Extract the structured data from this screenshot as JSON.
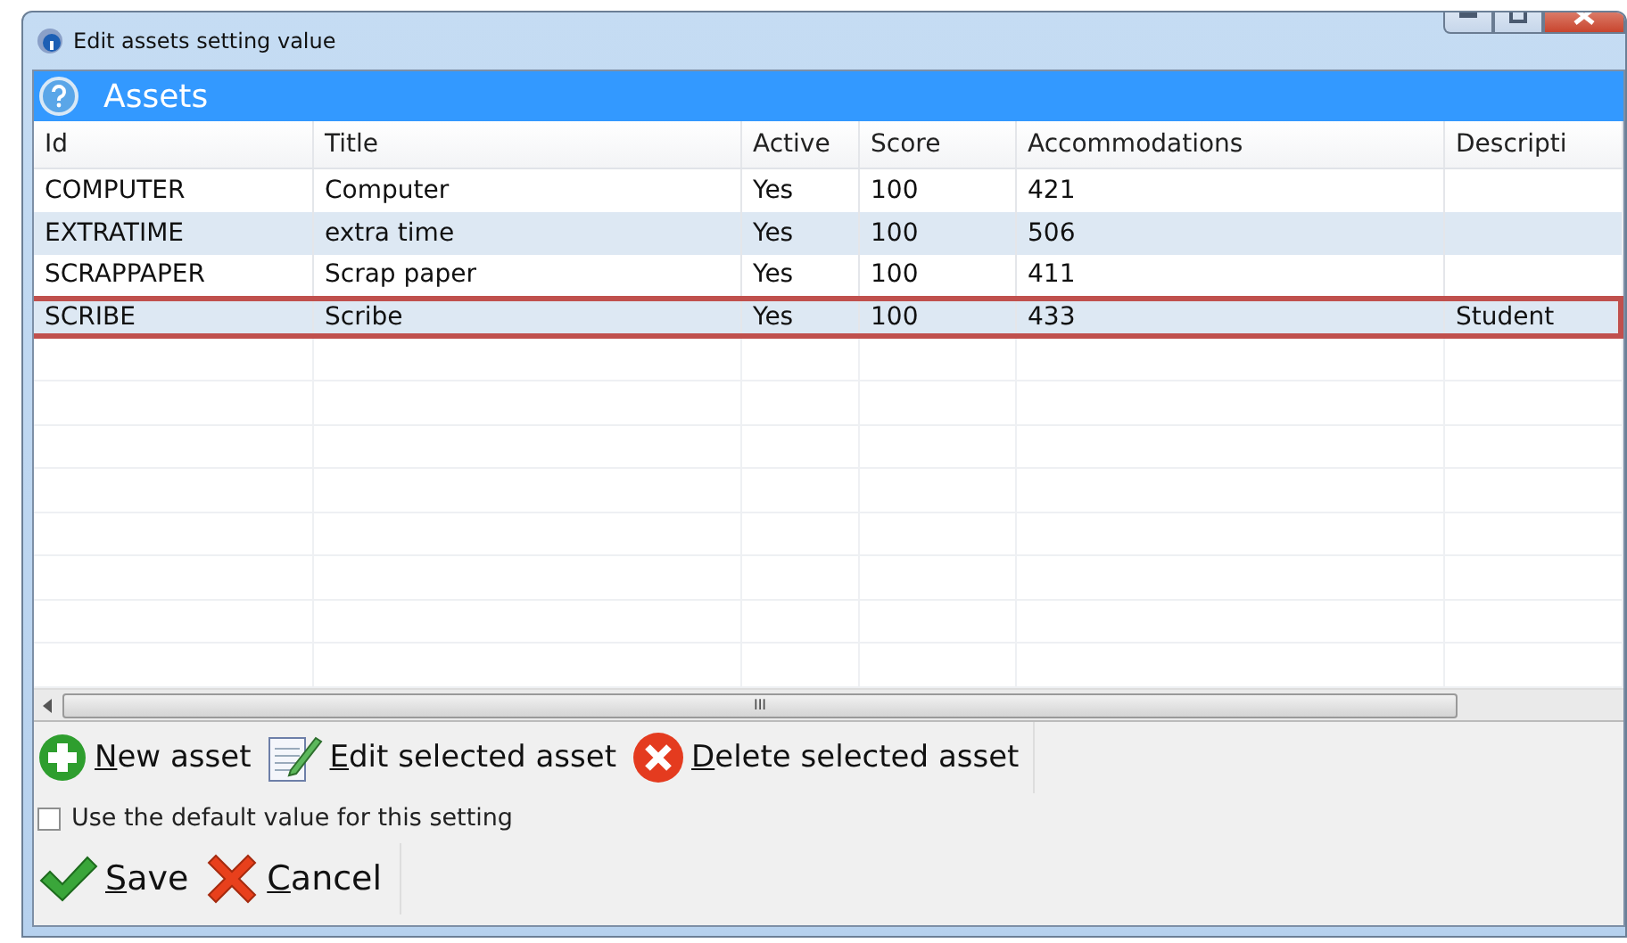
{
  "window": {
    "title": "Edit assets setting value"
  },
  "header": {
    "title": "Assets"
  },
  "table": {
    "columns": [
      "Id",
      "Title",
      "Active",
      "Score",
      "Accommodations",
      "Descripti"
    ],
    "rows": [
      {
        "cells": [
          "COMPUTER",
          "Computer",
          "Yes",
          "100",
          "421",
          ""
        ],
        "selected": false
      },
      {
        "cells": [
          "EXTRATIME",
          "extra time",
          "Yes",
          "100",
          "506",
          ""
        ],
        "selected": false
      },
      {
        "cells": [
          "SCRAPPAPER",
          "Scrap paper",
          "Yes",
          "100",
          "411",
          ""
        ],
        "selected": false
      },
      {
        "cells": [
          "SCRIBE",
          "Scribe",
          "Yes",
          "100",
          "433",
          "Student"
        ],
        "selected": true
      }
    ]
  },
  "scrollbar_arrow": "III",
  "actions": [
    {
      "kind": "new",
      "mnemonic": "N",
      "rest": "ew asset"
    },
    {
      "kind": "edit",
      "mnemonic": "E",
      "rest": "dit  selected asset"
    },
    {
      "kind": "delete",
      "mnemonic": "D",
      "rest": "elete selected asset"
    }
  ],
  "default_checkbox": {
    "label": "Use the default value for this setting",
    "checked": false
  },
  "buttons": [
    {
      "kind": "save",
      "mnemonic": "S",
      "rest": "ave"
    },
    {
      "kind": "cancel",
      "mnemonic": "C",
      "rest": "ancel"
    }
  ]
}
